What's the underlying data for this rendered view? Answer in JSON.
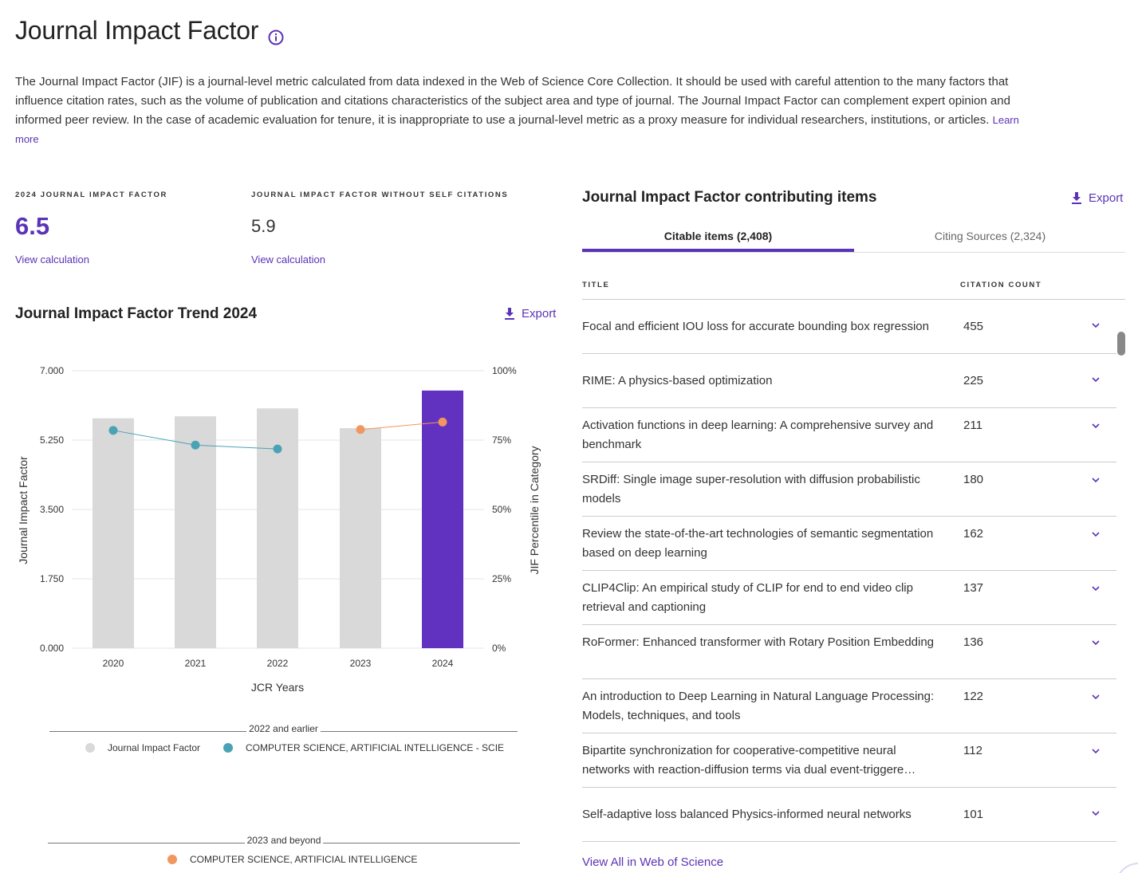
{
  "page": {
    "title": "Journal Impact Factor",
    "intro": "The Journal Impact Factor (JIF) is a journal-level metric calculated from data indexed in the Web of Science Core Collection. It should be used with careful attention to the many factors that influence citation rates, such as the volume of publication and citations characteristics of the subject area and type of journal. The Journal Impact Factor can complement expert opinion and informed peer review. In the case of academic evaluation for tenure, it is inappropriate to use a journal-level metric as a proxy measure for individual researchers, institutions, or articles.",
    "learn_more": "Learn more"
  },
  "metrics": {
    "jif_label": "2024 JOURNAL IMPACT FACTOR",
    "jif_value": "6.5",
    "jif_link": "View calculation",
    "no_self_label": "JOURNAL IMPACT FACTOR WITHOUT SELF CITATIONS",
    "no_self_value": "5.9",
    "no_self_link": "View calculation"
  },
  "trend": {
    "title": "Journal Impact Factor Trend 2024",
    "export_label": "Export"
  },
  "chart_data": {
    "type": "bar",
    "categories": [
      "2020",
      "2021",
      "2022",
      "2023",
      "2024"
    ],
    "xlabel": "JCR Years",
    "ylabel": "Journal Impact Factor",
    "y2label": "JIF Percentile in Category",
    "ylim": [
      0,
      7
    ],
    "y_ticks": [
      "0.000",
      "1.750",
      "3.500",
      "5.250",
      "7.000"
    ],
    "y2_ticks": [
      "0%",
      "25%",
      "50%",
      "75%",
      "100%"
    ],
    "grid": true,
    "bars": {
      "name": "Journal Impact Factor",
      "values": [
        5.8,
        5.85,
        6.05,
        5.55,
        6.5
      ],
      "colors": [
        "#d9d9d9",
        "#d9d9d9",
        "#d9d9d9",
        "#d9d9d9",
        "#6131c0"
      ]
    },
    "percentile_series": [
      {
        "name": "COMPUTER SCIENCE, ARTIFICIAL INTELLIGENCE - SCIE",
        "color": "#4aa3b5",
        "categories": [
          "2020",
          "2021",
          "2022"
        ],
        "values": [
          78.5,
          73.2,
          71.8
        ]
      },
      {
        "name": "COMPUTER SCIENCE, ARTIFICIAL INTELLIGENCE",
        "color": "#f2965f",
        "categories": [
          "2023",
          "2024"
        ],
        "values": [
          78.8,
          81.5
        ]
      }
    ]
  },
  "legend": {
    "group1_label": "2022 and earlier",
    "item_jif": "Journal Impact Factor",
    "item_scie": "COMPUTER SCIENCE, ARTIFICIAL INTELLIGENCE - SCIE",
    "group2_label": "2023 and beyond",
    "item_ai": "COMPUTER SCIENCE, ARTIFICIAL INTELLIGENCE"
  },
  "contributing": {
    "title": "Journal Impact Factor contributing items",
    "export_label": "Export",
    "tabs": [
      {
        "label": "Citable items (2,408)"
      },
      {
        "label": "Citing Sources (2,324)"
      }
    ],
    "col_title": "TITLE",
    "col_count": "CITATION COUNT",
    "items": [
      {
        "title": "Focal and efficient IOU loss for accurate bounding box regression",
        "count": "455"
      },
      {
        "title": "RIME: A physics-based optimization",
        "count": "225"
      },
      {
        "title": "Activation functions in deep learning: A comprehensive survey and benchmark",
        "count": "211"
      },
      {
        "title": "SRDiff: Single image super-resolution with diffusion probabilistic models",
        "count": "180"
      },
      {
        "title": "Review the state-of-the-art technologies of semantic segmentation based on deep learning",
        "count": "162"
      },
      {
        "title": "CLIP4Clip: An empirical study of CLIP for end to end video clip retrieval and captioning",
        "count": "137"
      },
      {
        "title": "RoFormer: Enhanced transformer with Rotary Position Embedding",
        "count": "136"
      },
      {
        "title": "An introduction to Deep Learning in Natural Language Processing: Models, techniques, and tools",
        "count": "122"
      },
      {
        "title": "Bipartite synchronization for cooperative-competitive neural networks with reaction-diffusion terms via dual event-triggere…",
        "count": "112"
      },
      {
        "title": "Self-adaptive loss balanced Physics-informed neural networks",
        "count": "101"
      }
    ],
    "view_all": "View All in Web of Science"
  },
  "colors": {
    "accent": "#5b33b6",
    "bar_current": "#6131c0",
    "bar_past": "#d9d9d9",
    "scie_line": "#4aa3b5",
    "ai_line": "#f2965f"
  }
}
